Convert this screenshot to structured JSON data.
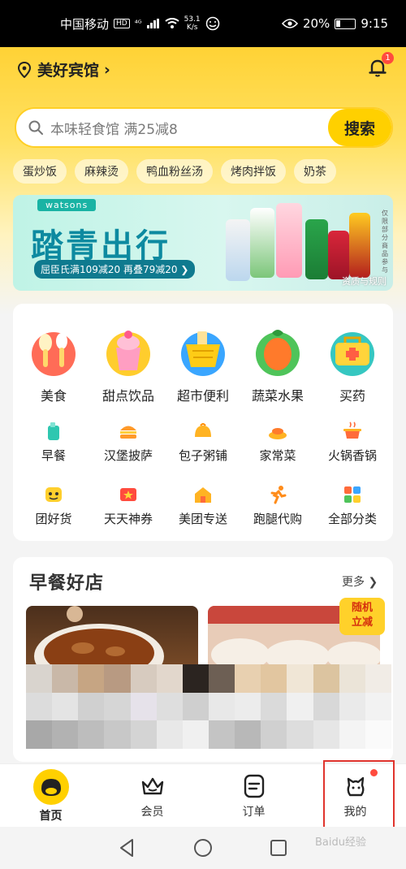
{
  "status": {
    "carrier": "中国移动",
    "hd": "HD",
    "signal": "⁴ᴳ",
    "speed_value": "53.1",
    "speed_unit": "K/s",
    "battery": "20%",
    "time": "9:15"
  },
  "header": {
    "location": "美好宾馆",
    "bell_badge": "1"
  },
  "search": {
    "placeholder": "本味轻食馆 满25减8",
    "button": "搜索"
  },
  "hot_tags": [
    "蛋炒饭",
    "麻辣烫",
    "鸭血粉丝汤",
    "烤肉拌饭",
    "奶茶"
  ],
  "banner": {
    "brand": "watsons",
    "title": "踏青出行",
    "promo": "屈臣氏满109减20 再叠79减20 ❯",
    "rules": "资质与规则",
    "side_note": "仅限部分商品参与"
  },
  "categories_big": [
    {
      "label": "美食",
      "icon": "food-icon"
    },
    {
      "label": "甜点饮品",
      "icon": "dessert-icon"
    },
    {
      "label": "超市便利",
      "icon": "supermarket-icon"
    },
    {
      "label": "蔬菜水果",
      "icon": "fruit-icon"
    },
    {
      "label": "买药",
      "icon": "medicine-icon"
    }
  ],
  "categories_small_1": [
    {
      "label": "早餐",
      "icon": "breakfast-icon"
    },
    {
      "label": "汉堡披萨",
      "icon": "burger-icon"
    },
    {
      "label": "包子粥铺",
      "icon": "bun-icon"
    },
    {
      "label": "家常菜",
      "icon": "dish-icon"
    },
    {
      "label": "火锅香锅",
      "icon": "hotpot-icon"
    }
  ],
  "categories_small_2": [
    {
      "label": "团好货",
      "icon": "group-buy-icon"
    },
    {
      "label": "天天神券",
      "icon": "coupon-icon"
    },
    {
      "label": "美团专送",
      "icon": "delivery-icon"
    },
    {
      "label": "跑腿代购",
      "icon": "runner-icon"
    },
    {
      "label": "全部分类",
      "icon": "grid-icon"
    }
  ],
  "breakfast": {
    "title": "早餐好店",
    "more": "更多 ❯",
    "tag_line1": "随机",
    "tag_line2": "立减"
  },
  "nav": [
    {
      "label": "首页",
      "icon": "home-icon",
      "active": true
    },
    {
      "label": "会员",
      "icon": "crown-icon"
    },
    {
      "label": "订单",
      "icon": "order-icon"
    },
    {
      "label": "我的",
      "icon": "profile-icon"
    }
  ],
  "watermark": "Baidu经验",
  "colors": {
    "brand_yellow": "#ffd000",
    "highlight_red": "#e0342d"
  }
}
